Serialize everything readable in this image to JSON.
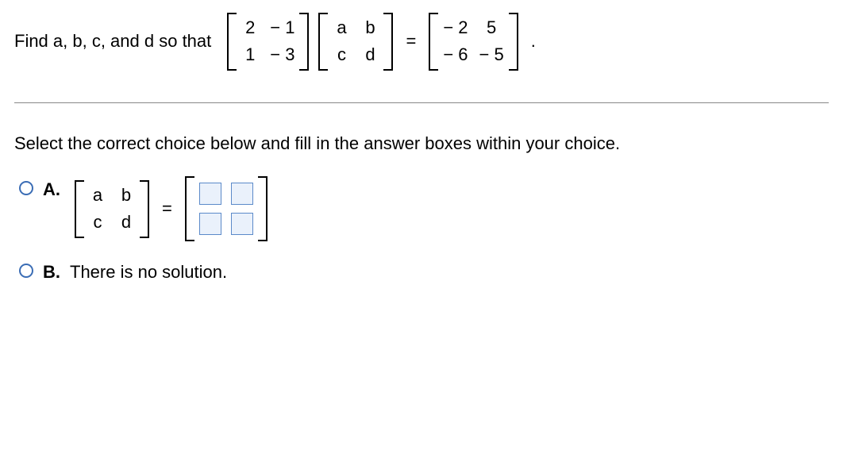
{
  "question": {
    "lead": "Find a, b, c, and d so that",
    "matrix1": {
      "r1c1": "2",
      "r1c2": "− 1",
      "r2c1": "1",
      "r2c2": "− 3"
    },
    "matrix2": {
      "r1c1": "a",
      "r1c2": "b",
      "r2c1": "c",
      "r2c2": "d"
    },
    "equals": "=",
    "matrix3": {
      "r1c1": "− 2",
      "r1c2": "5",
      "r2c1": "− 6",
      "r2c2": "− 5"
    },
    "period": "."
  },
  "instruction": "Select the correct choice below and fill in the answer boxes within your choice.",
  "choices": {
    "A": {
      "label": "A.",
      "left_matrix": {
        "r1c1": "a",
        "r1c2": "b",
        "r2c1": "c",
        "r2c2": "d"
      },
      "equals": "="
    },
    "B": {
      "label": "B.",
      "text": "There is no solution."
    }
  }
}
